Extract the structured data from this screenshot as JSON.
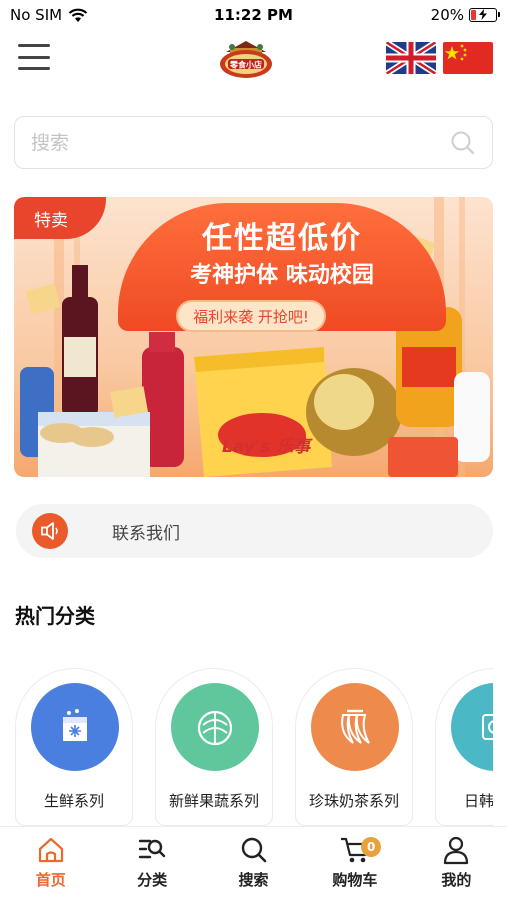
{
  "status": {
    "carrier": "No SIM",
    "time": "11:22 PM",
    "battery_text": "20%",
    "battery_level": 0.2
  },
  "header": {
    "logo_icon": "shop-logo",
    "flags": [
      "uk-flag-icon",
      "china-flag-icon"
    ]
  },
  "search": {
    "placeholder": "搜索",
    "value": ""
  },
  "banner": {
    "badge": "特卖",
    "title": "任性超低价",
    "subtitle": "考神护体 味动校园",
    "pill": "福利来袭 开抢吧!",
    "brand_mark": "Lay's 乐事"
  },
  "contact": {
    "label": "联系我们"
  },
  "categories": {
    "title": "热门分类",
    "items": [
      {
        "label": "生鲜系列",
        "color": "#4a7fe0",
        "icon": "frozen-box-icon"
      },
      {
        "label": "新鲜果蔬系列",
        "color": "#5fc79b",
        "icon": "cabbage-icon"
      },
      {
        "label": "珍珠奶茶系列",
        "color": "#ee8a4c",
        "icon": "banana-icon"
      },
      {
        "label": "日韩",
        "color": "#4bb8c6",
        "icon": "package-icon"
      }
    ]
  },
  "tabs": [
    {
      "label": "首页",
      "icon": "home-icon",
      "active": true
    },
    {
      "label": "分类",
      "icon": "category-icon"
    },
    {
      "label": "搜索",
      "icon": "search-icon"
    },
    {
      "label": "购物车",
      "icon": "cart-icon",
      "badge": "0"
    },
    {
      "label": "我的",
      "icon": "profile-icon"
    }
  ],
  "colors": {
    "accent": "#ec6a2c",
    "badge": "#e8a23d",
    "banner_red": "#e8452c"
  }
}
